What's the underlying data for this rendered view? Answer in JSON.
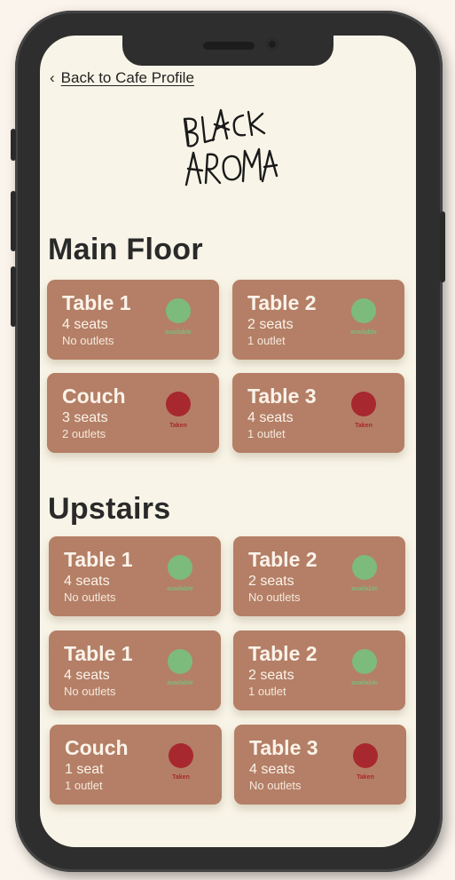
{
  "nav": {
    "back_chevron": "‹",
    "back_label": "Back to Cafe Profile"
  },
  "logo": {
    "line1": "BLACK",
    "line2": "AROMA"
  },
  "colors": {
    "available": "#7dbb7d",
    "taken": "#a8282f",
    "card": "#b47f66"
  },
  "sections": [
    {
      "title": "Main Floor",
      "tables": [
        {
          "name": "Table 1",
          "seats": "4 seats",
          "outlets": "No outlets",
          "status": "available"
        },
        {
          "name": "Table 2",
          "seats": "2 seats",
          "outlets": "1 outlet",
          "status": "available"
        },
        {
          "name": "Couch",
          "seats": "3 seats",
          "outlets": "2 outlets",
          "status": "Taken"
        },
        {
          "name": "Table 3",
          "seats": "4 seats",
          "outlets": "1 outlet",
          "status": "Taken"
        }
      ]
    },
    {
      "title": "Upstairs",
      "tables": [
        {
          "name": "Table 1",
          "seats": "4 seats",
          "outlets": "No outlets",
          "status": "available"
        },
        {
          "name": "Table 2",
          "seats": "2 seats",
          "outlets": "No outlets",
          "status": "available"
        },
        {
          "name": "Table 1",
          "seats": "4 seats",
          "outlets": "No outlets",
          "status": "available"
        },
        {
          "name": "Table 2",
          "seats": "2 seats",
          "outlets": "1 outlet",
          "status": "available"
        },
        {
          "name": "Couch",
          "seats": "1 seat",
          "outlets": "1 outlet",
          "status": "Taken"
        },
        {
          "name": "Table 3",
          "seats": "4 seats",
          "outlets": "No outlets",
          "status": "Taken"
        }
      ]
    }
  ]
}
